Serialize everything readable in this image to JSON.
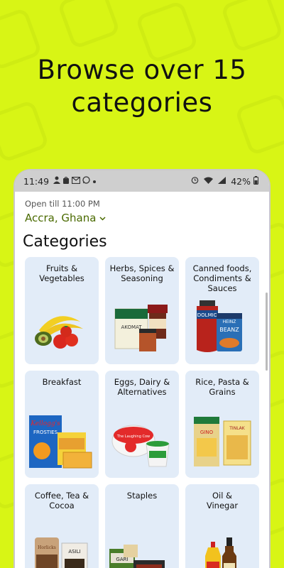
{
  "headline": "Browse over 15 categories",
  "status_bar": {
    "time": "11:49",
    "notif_icons": [
      "profile-icon",
      "bag-icon",
      "gmail-icon",
      "whatsapp-icon",
      "dot-icon"
    ],
    "battery": "42%"
  },
  "store": {
    "open_till": "Open till 11:00 PM",
    "location": "Accra, Ghana"
  },
  "section_title": "Categories",
  "categories": [
    {
      "label": "Fruits & Vegetables"
    },
    {
      "label": "Herbs, Spices & Seasoning"
    },
    {
      "label": "Canned foods, Condiments & Sauces"
    },
    {
      "label": "Breakfast"
    },
    {
      "label": "Eggs, Dairy & Alternatives"
    },
    {
      "label": "Rice, Pasta & Grains"
    },
    {
      "label": "Coffee, Tea & Cocoa"
    },
    {
      "label": "Staples"
    },
    {
      "label": "Oil & Vinegar"
    }
  ],
  "product_text": {
    "knorr": "AKOMAT",
    "dolmio": "DOLMIO",
    "heinz": "HEINZ",
    "beanz": "BEANZ",
    "kelloggs": "Kellogg's",
    "frosties": "FROSTIES",
    "laughing_cow": "The Laughing Cow",
    "gino": "GINO",
    "tinlak": "TINLAK",
    "horlicks": "Horlicks",
    "asili": "ASILI",
    "gari": "GARI"
  },
  "colors": {
    "background": "#d8f515",
    "accent_text": "#4a6a00",
    "card_bg": "#e2ecf8"
  }
}
